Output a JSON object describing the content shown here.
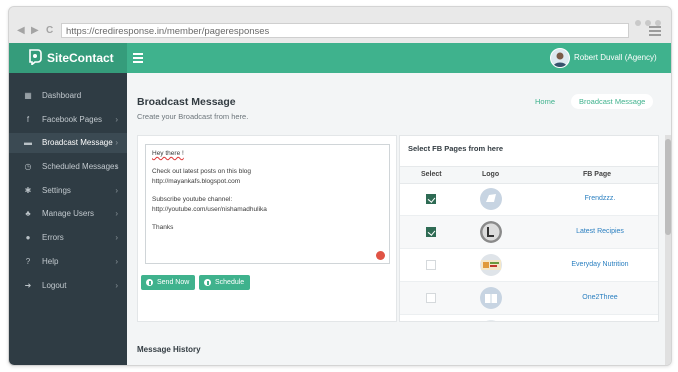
{
  "browser": {
    "url": "https://crediresponse.in/member/pageresponses",
    "back_glyph": "◀",
    "forward_glyph": "▶",
    "reload_glyph": "C"
  },
  "header": {
    "brand": "SiteContact",
    "user_name": "Robert Duvall (Agency)",
    "accent_color": "#3fb28d"
  },
  "sidebar": {
    "items": [
      {
        "label": "Dashboard",
        "icon": "dashboard-icon",
        "glyph": "▦",
        "chevron": ""
      },
      {
        "label": "Facebook Pages",
        "icon": "facebook-icon",
        "glyph": "f",
        "chevron": "›"
      },
      {
        "label": "Broadcast Message",
        "icon": "broadcast-icon",
        "glyph": "▬",
        "chevron": "›"
      },
      {
        "label": "Scheduled Messages",
        "icon": "clock-icon",
        "glyph": "◷",
        "chevron": "›"
      },
      {
        "label": "Settings",
        "icon": "gear-icon",
        "glyph": "✱",
        "chevron": "›"
      },
      {
        "label": "Manage Users",
        "icon": "users-icon",
        "glyph": "♣",
        "chevron": "›"
      },
      {
        "label": "Errors",
        "icon": "error-icon",
        "glyph": "●",
        "chevron": "›"
      },
      {
        "label": "Help",
        "icon": "help-icon",
        "glyph": "?",
        "chevron": "›"
      },
      {
        "label": "Logout",
        "icon": "logout-icon",
        "glyph": "➜",
        "chevron": "›"
      }
    ]
  },
  "main": {
    "title": "Broadcast Message",
    "subtitle": "Create your Broadcast from here.",
    "breadcrumb": {
      "home": "Home",
      "current": "Broadcast Message"
    },
    "editor_lines": [
      "Hey there !",
      "",
      "Check out latest posts on this blog",
      "http://mayankafs.blogspot.com",
      "",
      "Subscribe youtube channel:",
      "http://youtube.com/user/nishamadhulika",
      "",
      "Thanks"
    ],
    "send_now_label": "Send Now",
    "schedule_label": "Schedule",
    "fb_panel_title": "Select FB Pages from here",
    "table_headers": {
      "select": "Select",
      "logo": "Logo",
      "page": "FB Page"
    },
    "pages": [
      {
        "name": "Frendzzz.",
        "selected": true
      },
      {
        "name": "Latest Recipies",
        "selected": true
      },
      {
        "name": "Everyday Nutrition",
        "selected": false
      },
      {
        "name": "One2Three",
        "selected": false
      }
    ],
    "history_title": "Message History"
  }
}
